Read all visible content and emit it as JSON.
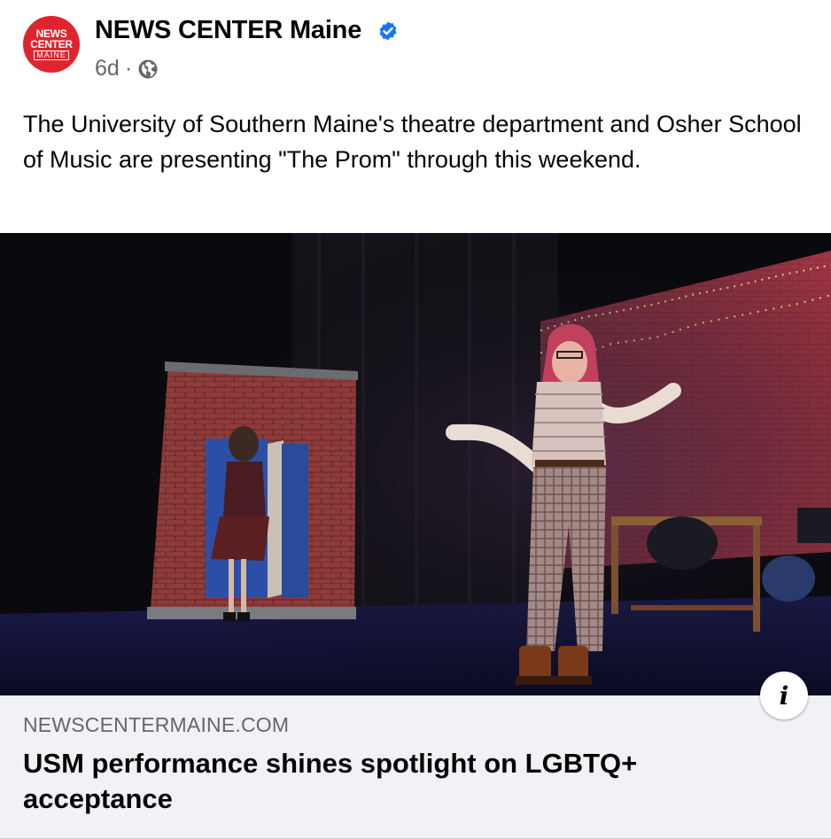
{
  "post": {
    "page_name": "NEWS CENTER Maine",
    "avatar": {
      "line1": "NEWS",
      "line2": "CENTER",
      "line3": "MAINE"
    },
    "time": "6d",
    "separator": "·",
    "audience_icon": "globe-icon",
    "verified_icon": "verified-badge-icon",
    "text": "The University of Southern Maine's theatre department and Osher School of Music are presenting \"The Prom\" through this weekend."
  },
  "link": {
    "domain": "NEWSCENTERMAINE.COM",
    "title": "USM performance shines spotlight on LGBTQ+ acceptance",
    "info_label": "i"
  },
  "colors": {
    "brand_red": "#e0242d",
    "verified_blue": "#1877f2",
    "card_bg": "#f0f2f5",
    "meta_gray": "#65676b"
  }
}
